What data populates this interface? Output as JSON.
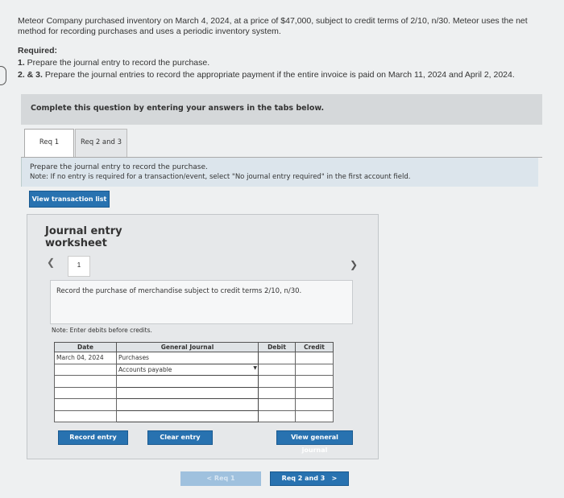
{
  "problem": {
    "intro": "Meteor Company purchased inventory on March 4, 2024, at a price of $47,000, subject to credit terms of 2/10, n/30. Meteor uses the net method for recording purchases and uses a periodic inventory system.",
    "required_heading": "Required:",
    "req1_num": "1.",
    "req1_text": " Prepare the journal entry to record the purchase.",
    "req2_num": "2. & 3.",
    "req2_text": " Prepare the journal entries to record the appropriate payment if the entire invoice is paid on March 11, 2024 and April 2, 2024."
  },
  "complete_banner": "Complete this question by entering your answers in the tabs below.",
  "tabs": [
    {
      "label": "Req 1",
      "active": true
    },
    {
      "label": "Req 2 and 3",
      "active": false
    }
  ],
  "instructions": {
    "line1": "Prepare the journal entry to record the purchase.",
    "line2": "Note: If no entry is required for a transaction/event, select \"No journal entry required\" in the first account field."
  },
  "view_transaction_list": "View transaction list",
  "worksheet": {
    "title_line1": "Journal entry",
    "title_line2": "worksheet",
    "prev_icon": "chevron-left-icon",
    "next_icon": "chevron-right-icon",
    "page_number": "1",
    "description": "Record the purchase of merchandise subject to credit terms 2/10, n/30.",
    "note": "Note: Enter debits before credits.",
    "columns": {
      "date": "Date",
      "general_journal": "General Journal",
      "debit": "Debit",
      "credit": "Credit"
    },
    "rows": [
      {
        "date": "March 04, 2024",
        "account": "Purchases",
        "debit": "",
        "credit": ""
      },
      {
        "date": "",
        "account": "Accounts payable",
        "debit": "",
        "credit": ""
      },
      {
        "date": "",
        "account": "",
        "debit": "",
        "credit": ""
      },
      {
        "date": "",
        "account": "",
        "debit": "",
        "credit": ""
      },
      {
        "date": "",
        "account": "",
        "debit": "",
        "credit": ""
      },
      {
        "date": "",
        "account": "",
        "debit": "",
        "credit": ""
      }
    ],
    "record_button": "Record entry",
    "clear_button": "Clear entry",
    "view_journal_button": "View general journal"
  },
  "bottom_nav": {
    "prev_label": "Req 1",
    "next_label": "Req 2 and 3"
  }
}
